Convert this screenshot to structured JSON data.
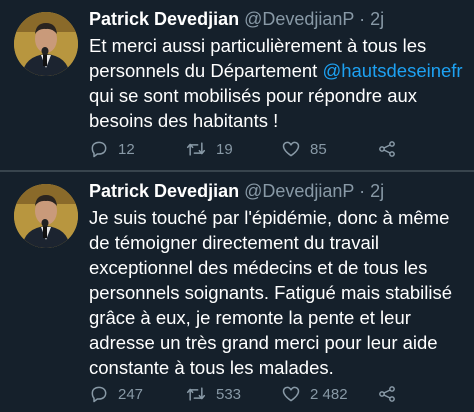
{
  "tweets": [
    {
      "author_name": "Patrick Devedjian",
      "handle_time": "@DevedjianP · 2j",
      "text_before": "Et merci aussi particulièrement à tous les personnels du Département ",
      "mention": "@hautsdeseinefr",
      "text_after": " qui se sont mobilisés pour répondre aux besoins des habitants !",
      "replies": "12",
      "retweets": "19",
      "likes": "85"
    },
    {
      "author_name": "Patrick Devedjian",
      "handle_time": "@DevedjianP · 2j",
      "text": "Je suis touché par l'épidémie, donc à même de témoigner directement du travail exceptionnel des médecins et de tous les personnels soignants. Fatigué mais stabilisé grâce à eux, je remonte la pente et leur adresse un très grand merci pour leur aide constante à tous les malades.",
      "replies": "247",
      "retweets": "533",
      "likes": "2 482"
    }
  ],
  "colors": {
    "background": "#15202b",
    "text": "#ffffff",
    "secondary": "#8899a6",
    "link": "#1da1f2",
    "divider": "#38444d"
  },
  "icons": [
    "reply-icon",
    "retweet-icon",
    "like-icon",
    "share-icon"
  ]
}
